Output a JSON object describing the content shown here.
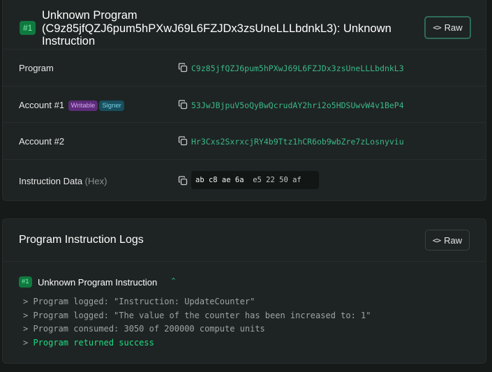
{
  "instruction_card": {
    "index_badge": "#1",
    "title": "Unknown Program (C9z85jfQZJ6pum5hPXwJ69L6FZJDx3zsUneLLLbdnkL3): Unknown Instruction",
    "raw_button_label": "Raw",
    "rows": {
      "program": {
        "label": "Program",
        "value": "C9z85jfQZJ6pum5hPXwJ69L6FZJDx3zsUneLLLbdnkL3"
      },
      "account1": {
        "label": "Account #1",
        "badge_writable": "Writable",
        "badge_signer": "Signer",
        "value": "53JwJBjpuV5oQyBwQcrudAY2hri2o5HDSUwvW4v1BeP4"
      },
      "account2": {
        "label": "Account #2",
        "value": "Hr3Cxs2SxrxcjRY4b9Ttz1hCR6ob9wbZre7zLosnyviu"
      },
      "instruction_data": {
        "label": "Instruction Data",
        "suffix": "(Hex)",
        "hex_part1": "ab c8 ae 6a",
        "hex_part2": "e5 22 50 af"
      }
    }
  },
  "logs_card": {
    "title": "Program Instruction Logs",
    "raw_button_label": "Raw",
    "entry": {
      "index_badge": "#1",
      "title": "Unknown Program Instruction",
      "lines": {
        "l1": "> Program logged: \"Instruction: UpdateCounter\"",
        "l2": "> Program logged: \"The value of the counter has been increased to: 1\"",
        "l3": "> Program consumed: 3050 of 200000 compute units",
        "l4_prefix": "> ",
        "l4_text": "Program returned success"
      }
    }
  },
  "icons": {
    "copy": "copy-icon",
    "code": "code-icon",
    "chevron_up": "chevron-up-icon"
  },
  "colors": {
    "background": "#161a19",
    "card": "#1e2423",
    "accent_green": "#3bb78a",
    "success": "#1fdc84",
    "writable_badge": "#5d2b7a",
    "signer_badge": "#174f5e"
  }
}
